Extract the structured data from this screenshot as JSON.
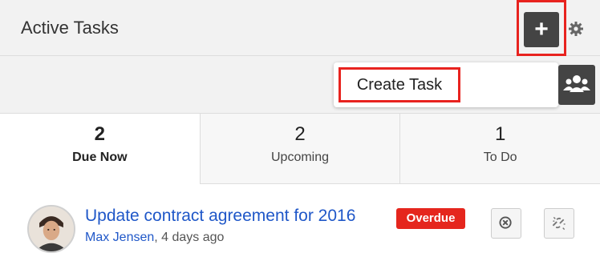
{
  "dashlet": {
    "title": "Active Tasks",
    "add_icon": "plus-icon",
    "settings_icon": "gear-icon"
  },
  "toolbar": {
    "create_task_label": "Create Task",
    "users_icon": "users-icon"
  },
  "tabs": [
    {
      "count": "2",
      "label": "Due Now",
      "active": true
    },
    {
      "count": "2",
      "label": "Upcoming",
      "active": false
    },
    {
      "count": "1",
      "label": "To Do",
      "active": false
    }
  ],
  "task": {
    "title": "Update contract agreement for 2016",
    "badge": "Overdue",
    "author": "Max Jensen",
    "time": ", 4 days ago",
    "close_icon": "close-circle-icon",
    "unlink_icon": "unlink-icon"
  },
  "colors": {
    "link": "#1f57c8",
    "highlight": "#e8231f",
    "overdue": "#e5261d",
    "button_dark": "#444444"
  }
}
